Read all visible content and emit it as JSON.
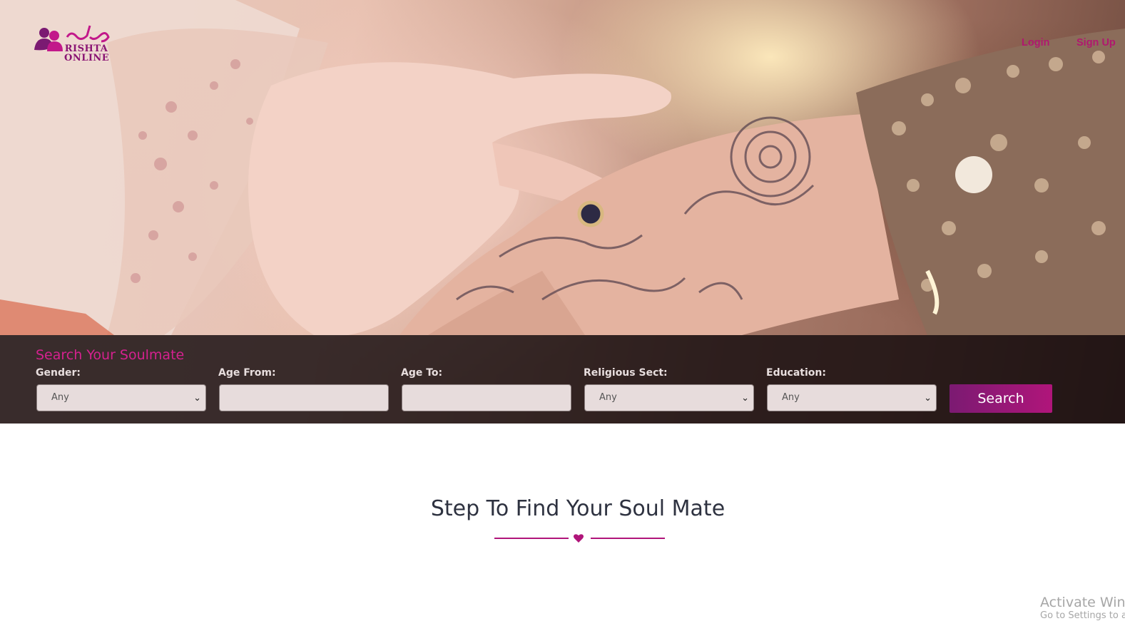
{
  "brand": {
    "logo_text_line1": "RISHTA",
    "logo_text_line2": "ONLINE",
    "accent": "#b0157a",
    "dark_purple": "#7b1a72"
  },
  "nav": {
    "login": "Login",
    "signup": "Sign Up"
  },
  "hero": {
    "image": "henna-hands-with-ring-and-bangles"
  },
  "search": {
    "title": "Search Your Soulmate",
    "fields": [
      {
        "label": "Gender:",
        "type": "select",
        "value": "Any"
      },
      {
        "label": "Age From:",
        "type": "input",
        "value": ""
      },
      {
        "label": "Age To:",
        "type": "input",
        "value": ""
      },
      {
        "label": "Religious Sect:",
        "type": "select",
        "value": "Any"
      },
      {
        "label": "Education:",
        "type": "select",
        "value": "Any"
      }
    ],
    "button": "Search"
  },
  "section": {
    "title": "Step To Find Your Soul Mate",
    "divider_icon": "heart-icon"
  },
  "watermark": {
    "line1": "Activate Windows",
    "line2": "Go to Settings to activate Windows."
  }
}
